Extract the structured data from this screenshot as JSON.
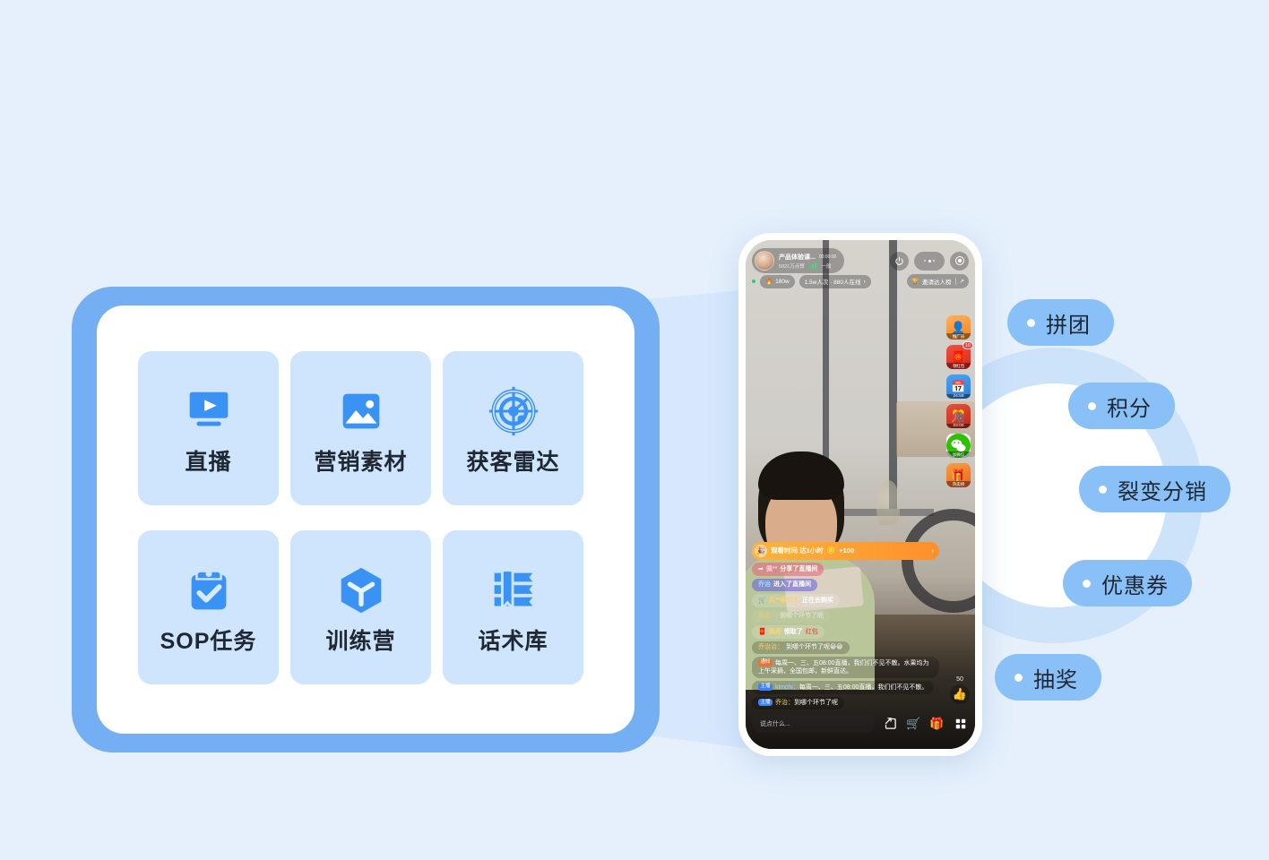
{
  "theme": {
    "background": "#e5f0fc",
    "panel_border": "#74aef3",
    "tile_bg": "#cfe4fd",
    "icon_blue": "#3b92f5",
    "pill_bg": "#89c0f7",
    "halo": "#b9d8f8"
  },
  "panel": {
    "tiles": [
      {
        "icon": "live-video-icon",
        "label": "直播"
      },
      {
        "icon": "image-material-icon",
        "label": "营销素材"
      },
      {
        "icon": "radar-icon",
        "label": "获客雷达"
      },
      {
        "icon": "clipboard-check-icon",
        "label": "SOP任务"
      },
      {
        "icon": "hexagon-cube-icon",
        "label": "训练营"
      },
      {
        "icon": "books-bookmark-icon",
        "label": "话术库"
      }
    ]
  },
  "phone": {
    "header": {
      "anchor_name": "产品体验课...",
      "stream_time": "00:00:00",
      "likes": "5021万点赞",
      "network": "一般",
      "power_icon": "power-icon",
      "more_icon": "more-dots-icon",
      "record_icon": "record-icon"
    },
    "stats": {
      "heat": "180w",
      "viewers": "1.5w人次 · 880人在线",
      "heat_icon": "flame-icon",
      "chevron": "chevron-right-icon",
      "invite_label": "邀请达人榜",
      "trophy_icon": "trophy-icon",
      "share_icon": "share-arrow-icon"
    },
    "rail": [
      {
        "icon": "promoter-icon",
        "label": "推广员",
        "badge": "",
        "timer": ""
      },
      {
        "icon": "redpacket-icon",
        "label": "领红包",
        "badge": "10",
        "timer": ""
      },
      {
        "icon": "calendar-icon",
        "label": "",
        "badge": "",
        "timer": "24:59"
      },
      {
        "icon": "fubag-icon",
        "label": "",
        "badge": "",
        "timer": "03:00"
      },
      {
        "icon": "wechat-icon",
        "label": "加微信",
        "badge": "",
        "timer": ""
      },
      {
        "icon": "gift-icon",
        "label": "热卖榜",
        "badge": "",
        "timer": ""
      }
    ],
    "chat": {
      "task": {
        "label": "观看时间 达1小时",
        "reward": "+100",
        "coin_icon": "coin-icon",
        "chevron": "chevron-right-icon",
        "emoji": "🎉"
      },
      "messages": [
        {
          "type": "share",
          "icon": "share-arrow-icon",
          "name": "佩**",
          "text": "分享了直播间"
        },
        {
          "type": "enter",
          "name": "乔治",
          "text": "进入了直播间"
        },
        {
          "type": "buy",
          "icon": "cart-icon",
          "name": "兵**等12人",
          "text": "正在去购买"
        },
        {
          "type": "fade",
          "name": "佩奇：",
          "text": "到哪个环节了呢"
        },
        {
          "type": "redpk",
          "icon": "redpacket-small-icon",
          "name": "佩奇",
          "text": "领取了",
          "highlight": "红包"
        },
        {
          "type": "plain",
          "name": "乔治治：",
          "text": "到哪个环节了呢😀😀"
        },
        {
          "type": "plain",
          "tag": "通知",
          "tag_kind": "notice",
          "text": "每周一、三、五08:00直播，我们们不见不散。水果均为上午采摘，全国包邮，新鲜直达。"
        },
        {
          "type": "plain",
          "tag": "主播",
          "tag_kind": "host",
          "name": "kimchi：",
          "text": "每周一、三、五08:00直播，我们们不见不散。"
        },
        {
          "type": "plain",
          "tag": "主播",
          "tag_kind": "host",
          "name": "乔治：",
          "text": "到哪个环节了呢"
        }
      ],
      "like_count": "50",
      "like_icon": "thumbs-up-icon"
    },
    "bottom": {
      "input_placeholder": "说点什么...",
      "icons": [
        {
          "icon": "share-box-icon",
          "glyph": "↗"
        },
        {
          "icon": "cart-icon",
          "glyph": "🛒"
        },
        {
          "icon": "gift-bag-icon",
          "glyph": "🎁"
        },
        {
          "icon": "grid-menu-icon",
          "glyph": "▦"
        }
      ]
    }
  },
  "pills": [
    {
      "label": "拼团"
    },
    {
      "label": "积分"
    },
    {
      "label": "裂变分销"
    },
    {
      "label": "优惠券"
    },
    {
      "label": "抽奖"
    }
  ]
}
